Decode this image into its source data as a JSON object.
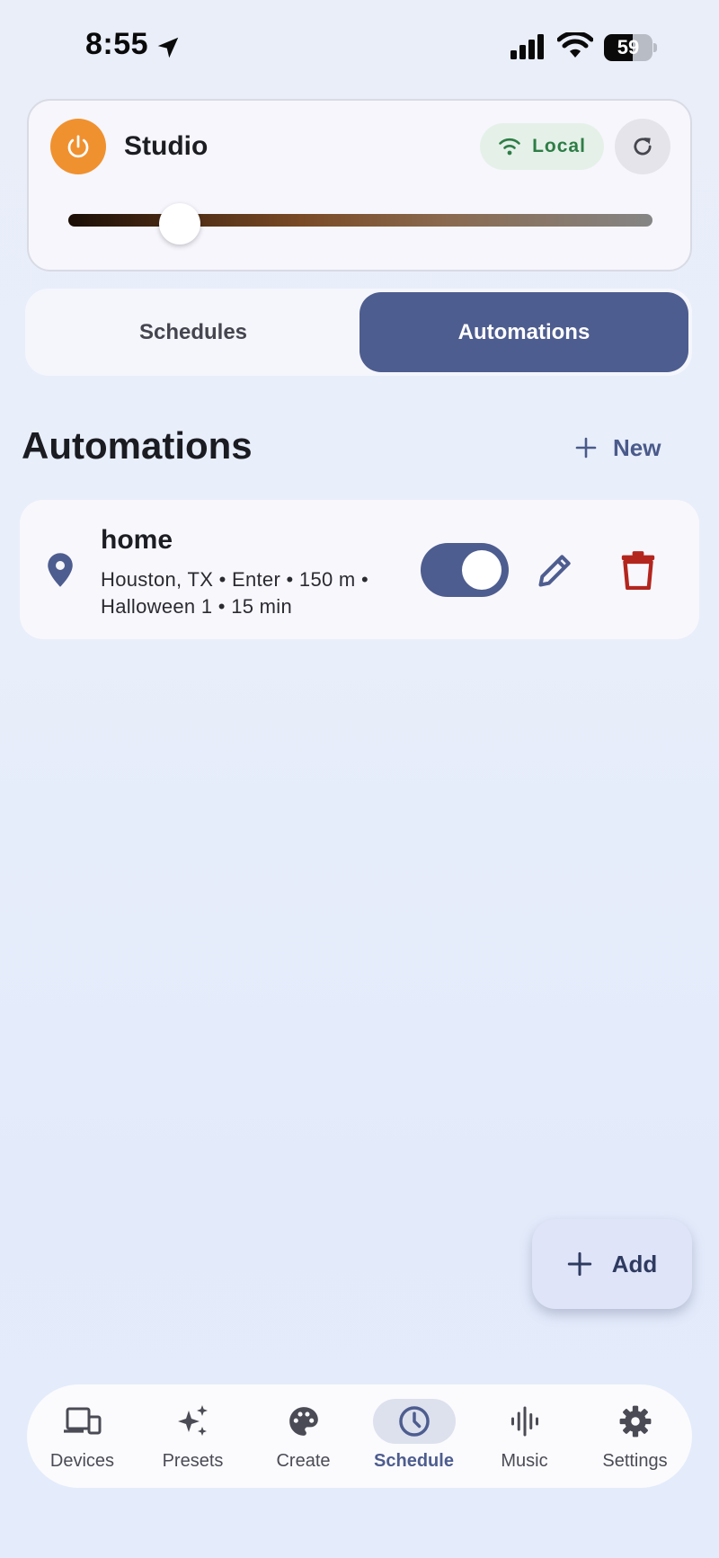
{
  "status_bar": {
    "time": "8:55",
    "battery_percent": "59",
    "battery_level": 0.59
  },
  "device": {
    "name": "Studio",
    "connection": "Local",
    "power_color": "#f0912f",
    "brightness": 0.19
  },
  "tabs": [
    {
      "label": "Schedules",
      "active": false
    },
    {
      "label": "Automations",
      "active": true
    }
  ],
  "section": {
    "title": "Automations",
    "new_label": "New"
  },
  "automations": [
    {
      "title": "home",
      "detail_line1": "Houston, TX • Enter • 150 m •",
      "detail_line2": "Halloween 1 • 15 min",
      "enabled": true
    }
  ],
  "fab": {
    "label": "Add"
  },
  "nav": [
    {
      "label": "Devices",
      "icon": "devices-icon",
      "active": false
    },
    {
      "label": "Presets",
      "icon": "sparkle-icon",
      "active": false
    },
    {
      "label": "Create",
      "icon": "palette-icon",
      "active": false
    },
    {
      "label": "Schedule",
      "icon": "clock-icon",
      "active": true
    },
    {
      "label": "Music",
      "icon": "waveform-icon",
      "active": false
    },
    {
      "label": "Settings",
      "icon": "gear-icon",
      "active": false
    }
  ],
  "colors": {
    "accent": "#4e5d8f",
    "delete": "#b3261e",
    "local_badge_text": "#2e7d46"
  }
}
